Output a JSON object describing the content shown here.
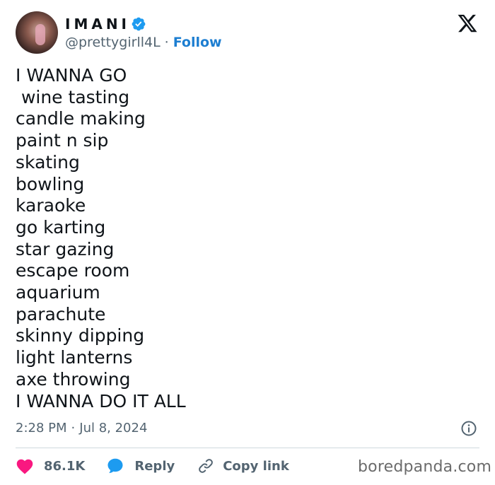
{
  "author": {
    "display_name": "IMANI",
    "handle": "@prettygirll4L",
    "separator": "·",
    "follow_label": "Follow"
  },
  "tweet": {
    "lines": [
      "I WANNA GO",
      " wine tasting",
      "candle making",
      "paint n sip",
      "skating",
      "bowling",
      "karaoke",
      "go karting",
      "star gazing",
      "escape room",
      "aquarium",
      "parachute",
      "skinny dipping",
      "light lanterns",
      "axe throwing",
      "I WANNA DO IT ALL"
    ],
    "time": "2:28 PM",
    "date_separator": "·",
    "date": "Jul 8, 2024"
  },
  "actions": {
    "likes": "86.1K",
    "reply_label": "Reply",
    "copy_link_label": "Copy link"
  },
  "watermark": "boredpanda.com",
  "colors": {
    "like_heart": "#f91880",
    "reply_bubble": "#1d9bf0",
    "verified_badge": "#1d9bf0",
    "follow_link": "#1d7ed1",
    "secondary_text": "#536471"
  },
  "icons": [
    "x-logo-icon",
    "verified-badge-icon",
    "info-icon",
    "heart-icon",
    "reply-icon",
    "link-icon"
  ]
}
